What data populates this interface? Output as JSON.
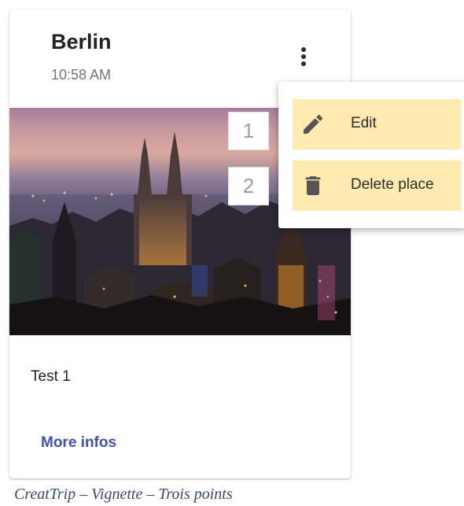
{
  "card": {
    "title": "Berlin",
    "time": "10:58 AM",
    "description": "Test 1",
    "more_link": "More infos",
    "image": "city-skyline-at-dusk"
  },
  "menu": {
    "trigger_icon": "more-vert-icon",
    "items": [
      {
        "label": "Edit",
        "icon": "pencil-icon"
      },
      {
        "label": "Delete place",
        "icon": "trash-icon"
      }
    ],
    "highlight_color": "#ffeab0"
  },
  "callouts": [
    "1",
    "2"
  ],
  "caption": "CreatTrip – Vignette – Trois points",
  "colors": {
    "accent": "#3f51b5",
    "title": "#222222",
    "subtitle": "#757575"
  }
}
